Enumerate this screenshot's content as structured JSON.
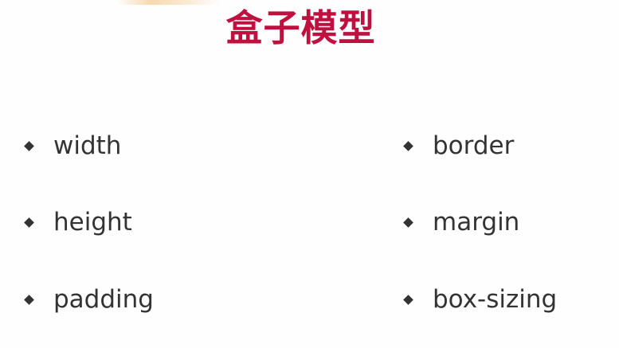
{
  "slide": {
    "title": "盒子模型",
    "bullets": [
      "width",
      "height",
      "padding",
      "border",
      "margin",
      "box-sizing"
    ]
  },
  "colors": {
    "title": "#c0103f",
    "text": "#333333",
    "background": "#fefefe"
  },
  "icons": {
    "bullet": "diamond-bullet-icon"
  }
}
